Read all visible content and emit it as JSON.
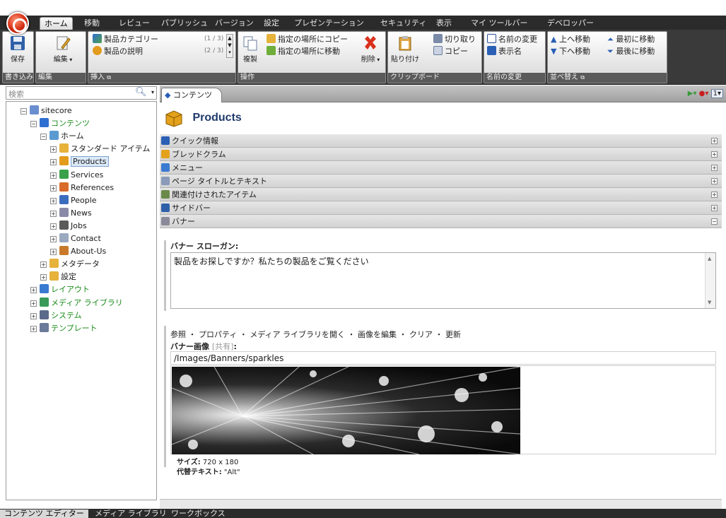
{
  "ribbon": {
    "tabs": [
      "ホーム",
      "移動",
      "レビュー",
      "パブリッシュ",
      "バージョン",
      "設定",
      "プレゼンテーション",
      "セキュリティ",
      "表示",
      "マイ ツールバー",
      "デベロッパー"
    ],
    "groups": {
      "write": {
        "label": "書き込み",
        "save": "保存"
      },
      "edit": {
        "label": "編集",
        "edit_btn": "編集"
      },
      "insert": {
        "label": "挿入",
        "item1": "製品カテゴリー",
        "item1_count": "(1 / 3)",
        "item2": "製品の説明",
        "item2_count": "(2 / 3)"
      },
      "operations": {
        "label": "操作",
        "duplicate": "複製",
        "copy_to": "指定の場所にコピー",
        "move_to": "指定の場所に移動",
        "delete": "削除"
      },
      "clipboard": {
        "label": "クリップボード",
        "paste": "貼り付け",
        "cut": "切り取り",
        "copy": "コピー"
      },
      "rename": {
        "label": "名前の変更",
        "rename": "名前の変更",
        "display_name": "表示名"
      },
      "sort": {
        "label": "並べ替え",
        "up": "上へ移動",
        "down": "下へ移動",
        "first": "最初に移動",
        "last": "最後に移動"
      }
    }
  },
  "search": {
    "placeholder": "検索"
  },
  "tree": [
    {
      "label": "sitecore",
      "level": 0,
      "pm": "⊟"
    },
    {
      "label": "コンテンツ",
      "level": 1,
      "pm": "⊟",
      "green": true
    },
    {
      "label": "ホーム",
      "level": 2,
      "pm": "⊟"
    },
    {
      "label": "スタンダード アイテム",
      "level": 3,
      "pm": "⊞"
    },
    {
      "label": "Products",
      "level": 3,
      "pm": "⊞",
      "selected": true
    },
    {
      "label": "Services",
      "level": 3,
      "pm": "⊞"
    },
    {
      "label": "References",
      "level": 3,
      "pm": "⊞"
    },
    {
      "label": "People",
      "level": 3,
      "pm": "⊞"
    },
    {
      "label": "News",
      "level": 3,
      "pm": "⊞"
    },
    {
      "label": "Jobs",
      "level": 3,
      "pm": "⊞"
    },
    {
      "label": "Contact",
      "level": 3,
      "pm": "⊞"
    },
    {
      "label": "About-Us",
      "level": 3,
      "pm": "⊞"
    },
    {
      "label": "メタデータ",
      "level": 2,
      "pm": "⊞"
    },
    {
      "label": "設定",
      "level": 2,
      "pm": "⊞"
    },
    {
      "label": "レイアウト",
      "level": 1,
      "pm": "⊞",
      "green": true
    },
    {
      "label": "メディア ライブラリ",
      "level": 1,
      "pm": "⊞",
      "green": true
    },
    {
      "label": "システム",
      "level": 1,
      "pm": "⊞",
      "green": true
    },
    {
      "label": "テンプレート",
      "level": 1,
      "pm": "⊞",
      "green": true
    }
  ],
  "content_tab": {
    "label": "コンテンツ",
    "page_number": "1"
  },
  "item": {
    "title": "Products"
  },
  "sections": [
    {
      "label": "クイック情報",
      "state": "⊞"
    },
    {
      "label": "ブレッドクラム",
      "state": "⊞"
    },
    {
      "label": "メニュー",
      "state": "⊞"
    },
    {
      "label": "ページ タイトルとテキスト",
      "state": "⊞"
    },
    {
      "label": "関連付けされたアイテム",
      "state": "⊞"
    },
    {
      "label": "サイドバー",
      "state": "⊞"
    },
    {
      "label": "バナー",
      "state": "⊟"
    }
  ],
  "banner": {
    "slogan_label": "バナー スローガン:",
    "slogan_value": "製品をお探しですか？私たちの製品をご覧ください",
    "image_actions": "参照 ・ プロパティ ・ メディア ライブラリを開く ・ 画像を編集 ・ クリア ・ 更新",
    "image_label": "バナー画像",
    "image_shared": "[共有]",
    "image_colon": ":",
    "image_path": "/Images/Banners/sparkles",
    "size_label": "サイズ:",
    "size_value": "720 x 180",
    "alt_label": "代替テキスト:",
    "alt_value": "\"Alt\""
  },
  "bottom_tabs": [
    "コンテンツ エディター",
    "メディア ライブラリ",
    "ワークボックス"
  ],
  "colors": {
    "ribbon_dark": "#2b2b2b",
    "title_blue": "#1f3a6b",
    "tree_green": "#1a8a1a"
  }
}
